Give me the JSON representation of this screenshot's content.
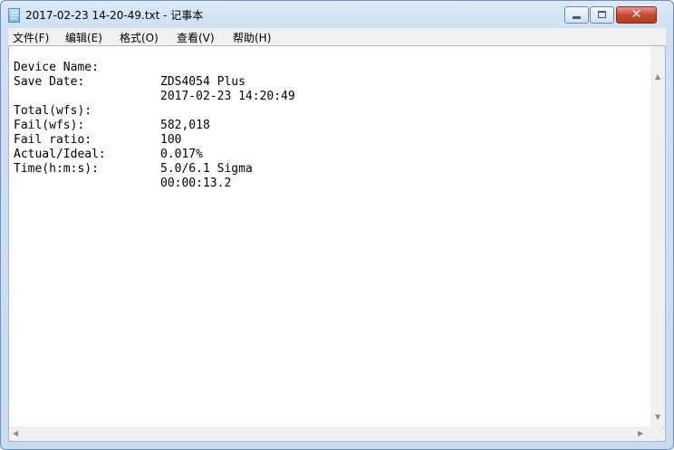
{
  "window": {
    "title": "2017-02-23 14-20-49.txt - 记事本"
  },
  "menu": [
    {
      "label": "文件(F)"
    },
    {
      "label": "编辑(E)"
    },
    {
      "label": "格式(O)"
    },
    {
      "label": "查看(V)"
    },
    {
      "label": "帮助(H)"
    }
  ],
  "content": {
    "lines": [
      {
        "key": "Device Name:",
        "value": "ZDS4054 Plus"
      },
      {
        "key": "Save Date:",
        "value": "2017-02-23 14:20:49"
      },
      {
        "key": "Total(wfs):",
        "value": "582,018"
      },
      {
        "key": "Fail(wfs):",
        "value": "100"
      },
      {
        "key": "Fail ratio:",
        "value": "0.017%"
      },
      {
        "key": "Actual/Ideal:",
        "value": "5.0/6.1 Sigma"
      },
      {
        "key": "Time(h:m:s):",
        "value": "00:00:13.2"
      }
    ]
  },
  "icons": {
    "app": "notepad-icon",
    "minimize": "minimize-icon",
    "maximize": "maximize-icon",
    "close": "close-icon",
    "scroll_up": "chevron-up-icon",
    "scroll_down": "chevron-down-icon",
    "scroll_left": "chevron-left-icon",
    "scroll_right": "chevron-right-icon",
    "grip": "resize-grip-icon"
  },
  "colors": {
    "title_bar": "#cfe0f3",
    "close_button": "#c54a32",
    "menu_bar": "#f0f0f0",
    "editor_background": "#ffffff"
  }
}
